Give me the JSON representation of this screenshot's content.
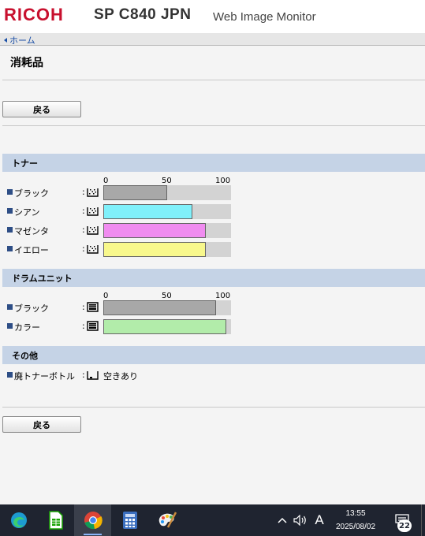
{
  "header": {
    "brand": "RICOH",
    "model": "SP C840 JPN",
    "subtitle": "Web Image Monitor"
  },
  "breadcrumb": {
    "home_label": "ホーム"
  },
  "page": {
    "title": "消耗品",
    "back_label": "戻る"
  },
  "scale_labels": [
    "0",
    "50",
    "100"
  ],
  "toner": {
    "title": "トナー",
    "items": [
      {
        "label": "ブラック",
        "colon": ":",
        "level": 50,
        "color": "#a8a8a8"
      },
      {
        "label": "シアン",
        "colon": ":",
        "level": 70,
        "color": "#80f0fa"
      },
      {
        "label": "マゼンタ",
        "colon": ":",
        "level": 80,
        "color": "#f08cf0"
      },
      {
        "label": "イエロー",
        "colon": ":",
        "level": 80,
        "color": "#f8f88c"
      }
    ]
  },
  "drum": {
    "title": "ドラムユニット",
    "items": [
      {
        "label": "ブラック",
        "colon": ":",
        "level": 88,
        "color": "#a8a8a8"
      },
      {
        "label": "カラー",
        "colon": ":",
        "level": 96,
        "color": "#b2ecaa"
      }
    ]
  },
  "other": {
    "title": "その他",
    "waste_label": "廃トナーボトル",
    "colon": ":",
    "waste_status": "空きあり"
  },
  "taskbar": {
    "apps": [
      "edge-icon",
      "libreoffice-calc-icon",
      "chrome-icon",
      "calculator-icon",
      "paint-icon"
    ],
    "clock_time": "13:55",
    "clock_date": "2025/08/02",
    "notification_count": "22",
    "ime_label": "A"
  }
}
